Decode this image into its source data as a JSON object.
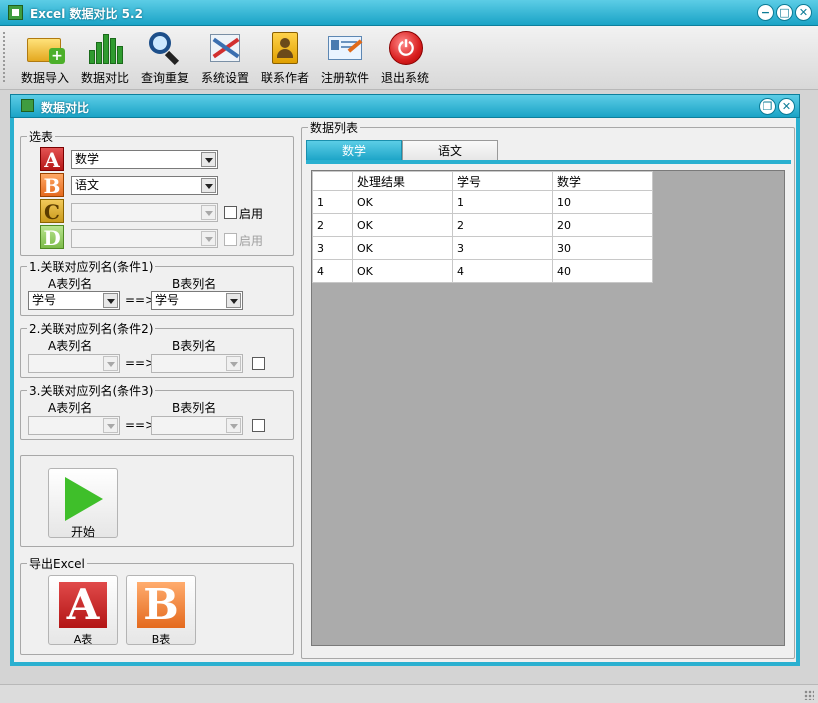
{
  "window": {
    "title": "Excel 数据对比 5.2",
    "minimize": "−",
    "maximize": "□",
    "close": "✕"
  },
  "toolbar": {
    "items": [
      {
        "label": "数据导入",
        "icon": "folder-plus-icon"
      },
      {
        "label": "数据对比",
        "icon": "bar-chart-icon"
      },
      {
        "label": "查询重复",
        "icon": "magnifier-icon"
      },
      {
        "label": "系统设置",
        "icon": "tools-icon"
      },
      {
        "label": "联系作者",
        "icon": "contact-book-icon"
      },
      {
        "label": "注册软件",
        "icon": "register-card-icon"
      },
      {
        "label": "退出系统",
        "icon": "power-icon"
      }
    ]
  },
  "child": {
    "title": "数据对比",
    "restore": "❐",
    "close": "✕"
  },
  "select_tables": {
    "legend": "选表",
    "rows": [
      {
        "letter": "A",
        "value": "数学",
        "enabled_label": ""
      },
      {
        "letter": "B",
        "value": "语文",
        "enabled_label": ""
      },
      {
        "letter": "C",
        "value": "",
        "enabled_label": "启用"
      },
      {
        "letter": "D",
        "value": "",
        "enabled_label": "启用"
      }
    ]
  },
  "conditions": [
    {
      "legend": "1.关联对应列名(条件1)",
      "a_label": "A表列名",
      "b_label": "B表列名",
      "a_value": "学号",
      "b_value": "学号",
      "arrow": "==>"
    },
    {
      "legend": "2.关联对应列名(条件2)",
      "a_label": "A表列名",
      "b_label": "B表列名",
      "a_value": "",
      "b_value": "",
      "arrow": "==>"
    },
    {
      "legend": "3.关联对应列名(条件3)",
      "a_label": "A表列名",
      "b_label": "B表列名",
      "a_value": "",
      "b_value": "",
      "arrow": "==>"
    }
  ],
  "start_button": {
    "label": "开始"
  },
  "export": {
    "legend": "导出Excel",
    "a_label": "A表",
    "b_label": "B表",
    "a_letter": "A",
    "b_letter": "B"
  },
  "data_list": {
    "legend": "数据列表",
    "tabs": [
      "数学",
      "语文"
    ],
    "active_tab": 0,
    "columns": [
      "处理结果",
      "学号",
      "数学"
    ],
    "rows": [
      {
        "num": "1",
        "cells": [
          "OK",
          "1",
          "10"
        ]
      },
      {
        "num": "2",
        "cells": [
          "OK",
          "2",
          "20"
        ]
      },
      {
        "num": "3",
        "cells": [
          "OK",
          "3",
          "30"
        ]
      },
      {
        "num": "4",
        "cells": [
          "OK",
          "4",
          "40"
        ]
      }
    ]
  },
  "colors": {
    "accent": "#1aa3c6",
    "title_grad_top": "#5ccde6",
    "grid_bg": "#ababab"
  }
}
